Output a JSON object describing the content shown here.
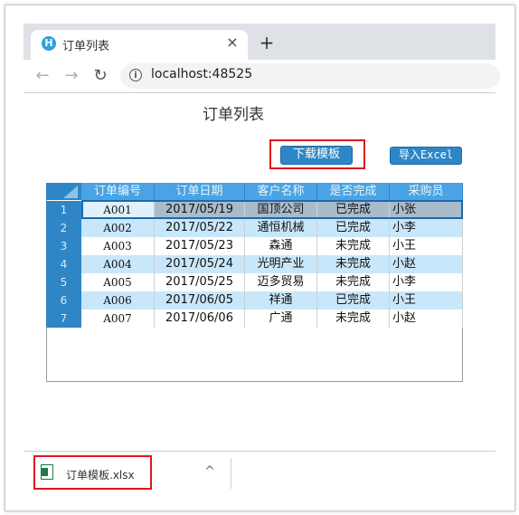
{
  "browser": {
    "tab_title": "订单列表",
    "tab_favicon_letter": "H",
    "close_glyph": "×",
    "new_tab_glyph": "+",
    "back_glyph": "←",
    "forward_glyph": "→",
    "reload_glyph": "↻",
    "info_glyph": "i",
    "url": "localhost:48525"
  },
  "page": {
    "title": "订单列表",
    "download_button": "下载模板",
    "import_button": "导入Excel"
  },
  "table": {
    "columns": [
      "订单编号",
      "订单日期",
      "客户名称",
      "是否完成",
      "采购员"
    ],
    "rows": [
      {
        "no": "1",
        "id": "A001",
        "date": "2017/05/19",
        "customer": "国顶公司",
        "status": "已完成",
        "buyer": "小张"
      },
      {
        "no": "2",
        "id": "A002",
        "date": "2017/05/22",
        "customer": "通恒机械",
        "status": "已完成",
        "buyer": "小李"
      },
      {
        "no": "3",
        "id": "A003",
        "date": "2017/05/23",
        "customer": "森通",
        "status": "未完成",
        "buyer": "小王"
      },
      {
        "no": "4",
        "id": "A004",
        "date": "2017/05/24",
        "customer": "光明产业",
        "status": "未完成",
        "buyer": "小赵"
      },
      {
        "no": "5",
        "id": "A005",
        "date": "2017/05/25",
        "customer": "迈多贸易",
        "status": "未完成",
        "buyer": "小李"
      },
      {
        "no": "6",
        "id": "A006",
        "date": "2017/06/05",
        "customer": "祥通",
        "status": "已完成",
        "buyer": "小王"
      },
      {
        "no": "7",
        "id": "A007",
        "date": "2017/06/06",
        "customer": "广通",
        "status": "未完成",
        "buyer": "小赵"
      }
    ],
    "selected_row": 1
  },
  "downloads": {
    "file_name": "订单模板.xlsx",
    "chevron_glyph": "^"
  },
  "colors": {
    "header_blue": "#4aa3e2",
    "rownum_blue": "#2f86c6",
    "alt_row": "#c9e7fa",
    "selected_cell": "#a9bccb",
    "highlight_red": "#e0141e"
  }
}
